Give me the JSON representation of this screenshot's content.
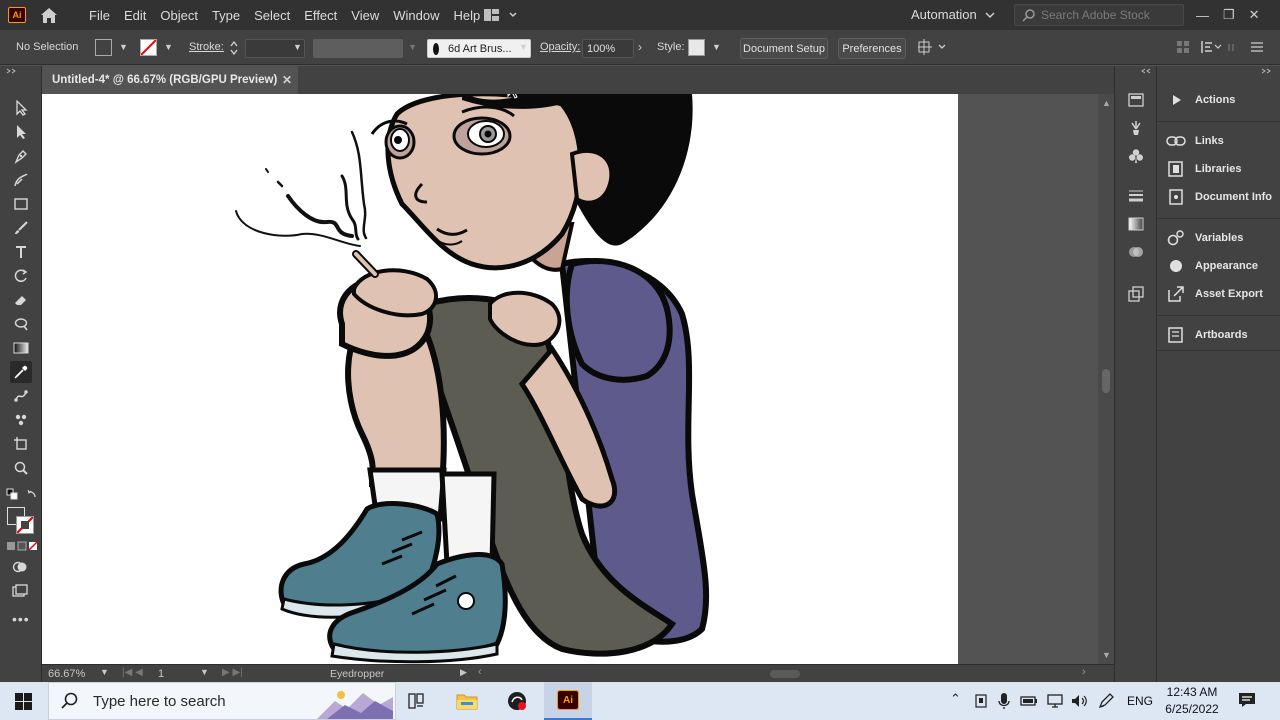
{
  "app": {
    "logo_text": "Ai"
  },
  "menu": [
    "File",
    "Edit",
    "Object",
    "Type",
    "Select",
    "Effect",
    "View",
    "Window",
    "Help"
  ],
  "workspace": {
    "label": "Automation"
  },
  "search_stock": {
    "placeholder": "Search Adobe Stock"
  },
  "control_bar": {
    "selection": "No Selection",
    "stroke_label": "Stroke:",
    "brush": "6d Art Brus...",
    "opacity_label": "Opacity:",
    "opacity_value": "100%",
    "style_label": "Style:",
    "document_setup": "Document Setup",
    "preferences": "Preferences"
  },
  "document": {
    "tab_title": "Untitled-4* @ 66.67% (RGB/GPU Preview)"
  },
  "status": {
    "zoom": "66.67%",
    "artboard_number": "1",
    "tool": "Eyedropper"
  },
  "panels": [
    {
      "icon": "play-icon",
      "label": "Actions"
    },
    {
      "icon": "links-icon",
      "label": "Links"
    },
    {
      "icon": "libraries-icon",
      "label": "Libraries"
    },
    {
      "icon": "document-info-icon",
      "label": "Document Info"
    },
    {
      "icon": "variables-icon",
      "label": "Variables"
    },
    {
      "icon": "appearance-icon",
      "label": "Appearance"
    },
    {
      "icon": "asset-export-icon",
      "label": "Asset Export"
    },
    {
      "icon": "artboards-icon",
      "label": "Artboards"
    }
  ],
  "taskbar": {
    "search_placeholder": "Type here to search",
    "lang": "ENG",
    "time": "12:43 AM",
    "date": "6/25/2022"
  },
  "colors": {
    "skin": "#e0c2b3",
    "shirt": "#5e5a8c",
    "pants": "#5c5c52",
    "shoes": "#4f7e8e",
    "hair": "#0a0a0a",
    "ui_dark": "#323232",
    "ui_panel": "#424242"
  }
}
